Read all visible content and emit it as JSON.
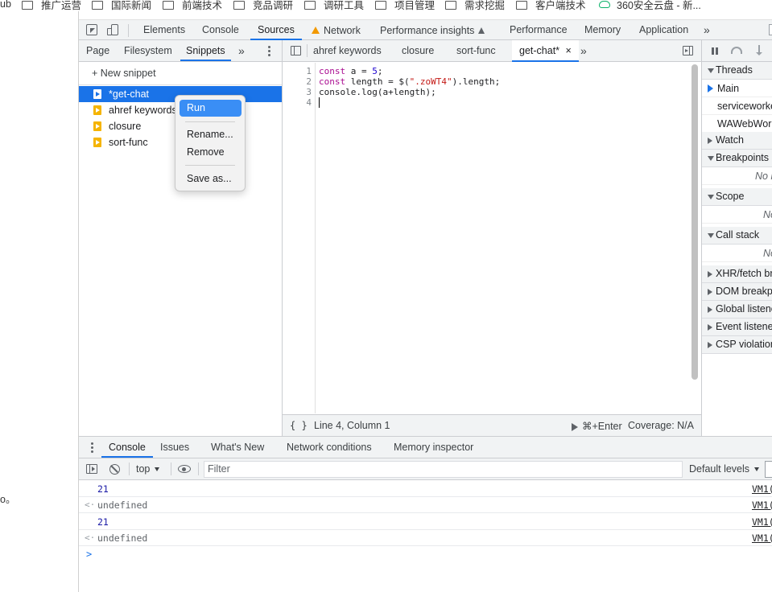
{
  "bookmarks": [
    {
      "label": "ub",
      "icon": "none"
    },
    {
      "label": "推广运营",
      "icon": "folder-icon"
    },
    {
      "label": "国际新闻",
      "icon": "folder-icon"
    },
    {
      "label": "前端技术",
      "icon": "folder-icon"
    },
    {
      "label": "竞品调研",
      "icon": "folder-icon"
    },
    {
      "label": "调研工具",
      "icon": "folder-icon"
    },
    {
      "label": "项目管理",
      "icon": "folder-icon"
    },
    {
      "label": "需求挖掘",
      "icon": "folder-icon"
    },
    {
      "label": "客户端技术",
      "icon": "folder-icon"
    },
    {
      "label": "360安全云盘 - 新...",
      "icon": "cloud-icon"
    }
  ],
  "left_page": {
    "fragment": "o。"
  },
  "devtools": {
    "main_tabs": [
      {
        "label": "Elements"
      },
      {
        "label": "Console"
      },
      {
        "label": "Sources",
        "active": true
      },
      {
        "label": "Network",
        "warning": true
      },
      {
        "label": "Performance insights",
        "flask": true
      },
      {
        "label": "Performance"
      },
      {
        "label": "Memory"
      },
      {
        "label": "Application"
      },
      {
        "label": "»"
      }
    ],
    "navigator": {
      "tabs": [
        {
          "label": "Page"
        },
        {
          "label": "Filesystem"
        },
        {
          "label": "Snippets",
          "active": true
        },
        {
          "label": "»"
        }
      ],
      "new_snippet": "+ New snippet",
      "snippets": [
        {
          "label": "*get-chat",
          "selected": true
        },
        {
          "label": "ahref keywords"
        },
        {
          "label": "closure"
        },
        {
          "label": "sort-func"
        }
      ]
    },
    "context_menu": {
      "items": [
        {
          "label": "Run",
          "highlighted": true
        },
        {
          "label": "Rename..."
        },
        {
          "label": "Remove"
        },
        {
          "label": "Save as..."
        }
      ]
    },
    "editor": {
      "tabs": [
        {
          "label": "ahref keywords"
        },
        {
          "label": "closure"
        },
        {
          "label": "sort-func"
        },
        {
          "label": "get-chat*",
          "active": true
        },
        {
          "label": "»"
        }
      ],
      "close_glyph": "×",
      "line_numbers": [
        "1",
        "2",
        "3",
        "4"
      ],
      "code": {
        "l1": {
          "kw": "const",
          "rest1": " a = ",
          "num": "5",
          "rest2": ";"
        },
        "l2": {
          "kw": "const",
          "rest1": " length = $(",
          "str": "\".zoWT4\"",
          "rest2": ").length;"
        },
        "l3": {
          "rest": "console.log(a+length);"
        }
      },
      "status": {
        "format": "{ }",
        "position": "Line 4, Column 1",
        "run": "⌘+Enter",
        "coverage": "Coverage: N/A"
      }
    },
    "debugger": {
      "sections": [
        {
          "label": "Threads",
          "open": true
        },
        {
          "label": "Watch",
          "open": false
        },
        {
          "label": "Breakpoints",
          "open": true
        },
        {
          "label": "Scope",
          "open": true
        },
        {
          "label": "Call stack",
          "open": true
        },
        {
          "label": "XHR/fetch br",
          "open": false
        },
        {
          "label": "DOM breakpo",
          "open": false
        },
        {
          "label": "Global listene",
          "open": false
        },
        {
          "label": "Event listener",
          "open": false
        },
        {
          "label": "CSP violation",
          "open": false
        }
      ],
      "threads": [
        "Main",
        "serviceworke",
        "WAWebWork"
      ],
      "breakpoints_empty": "No b",
      "scope_empty": "No",
      "callstack_empty": "No"
    },
    "drawer": {
      "tabs": [
        {
          "label": "Console",
          "active": true
        },
        {
          "label": "Issues"
        },
        {
          "label": "What's New"
        },
        {
          "label": "Network conditions"
        },
        {
          "label": "Memory inspector"
        }
      ],
      "toolbar": {
        "context": "top",
        "filter_placeholder": "Filter",
        "levels": "Default levels"
      },
      "rows": [
        {
          "value": "21",
          "kind": "output",
          "source": "VM1("
        },
        {
          "value": "undefined",
          "kind": "return",
          "source": "VM1("
        },
        {
          "value": "21",
          "kind": "output",
          "source": "VM1("
        },
        {
          "value": "undefined",
          "kind": "return",
          "source": "VM1("
        }
      ],
      "prompt": ">"
    }
  },
  "colors": {
    "accent": "#1a73e8",
    "menu_highlight": "#3a8ef5",
    "snippet_icon": "#f5b400",
    "toolbar_bg": "#f1f3f4"
  }
}
